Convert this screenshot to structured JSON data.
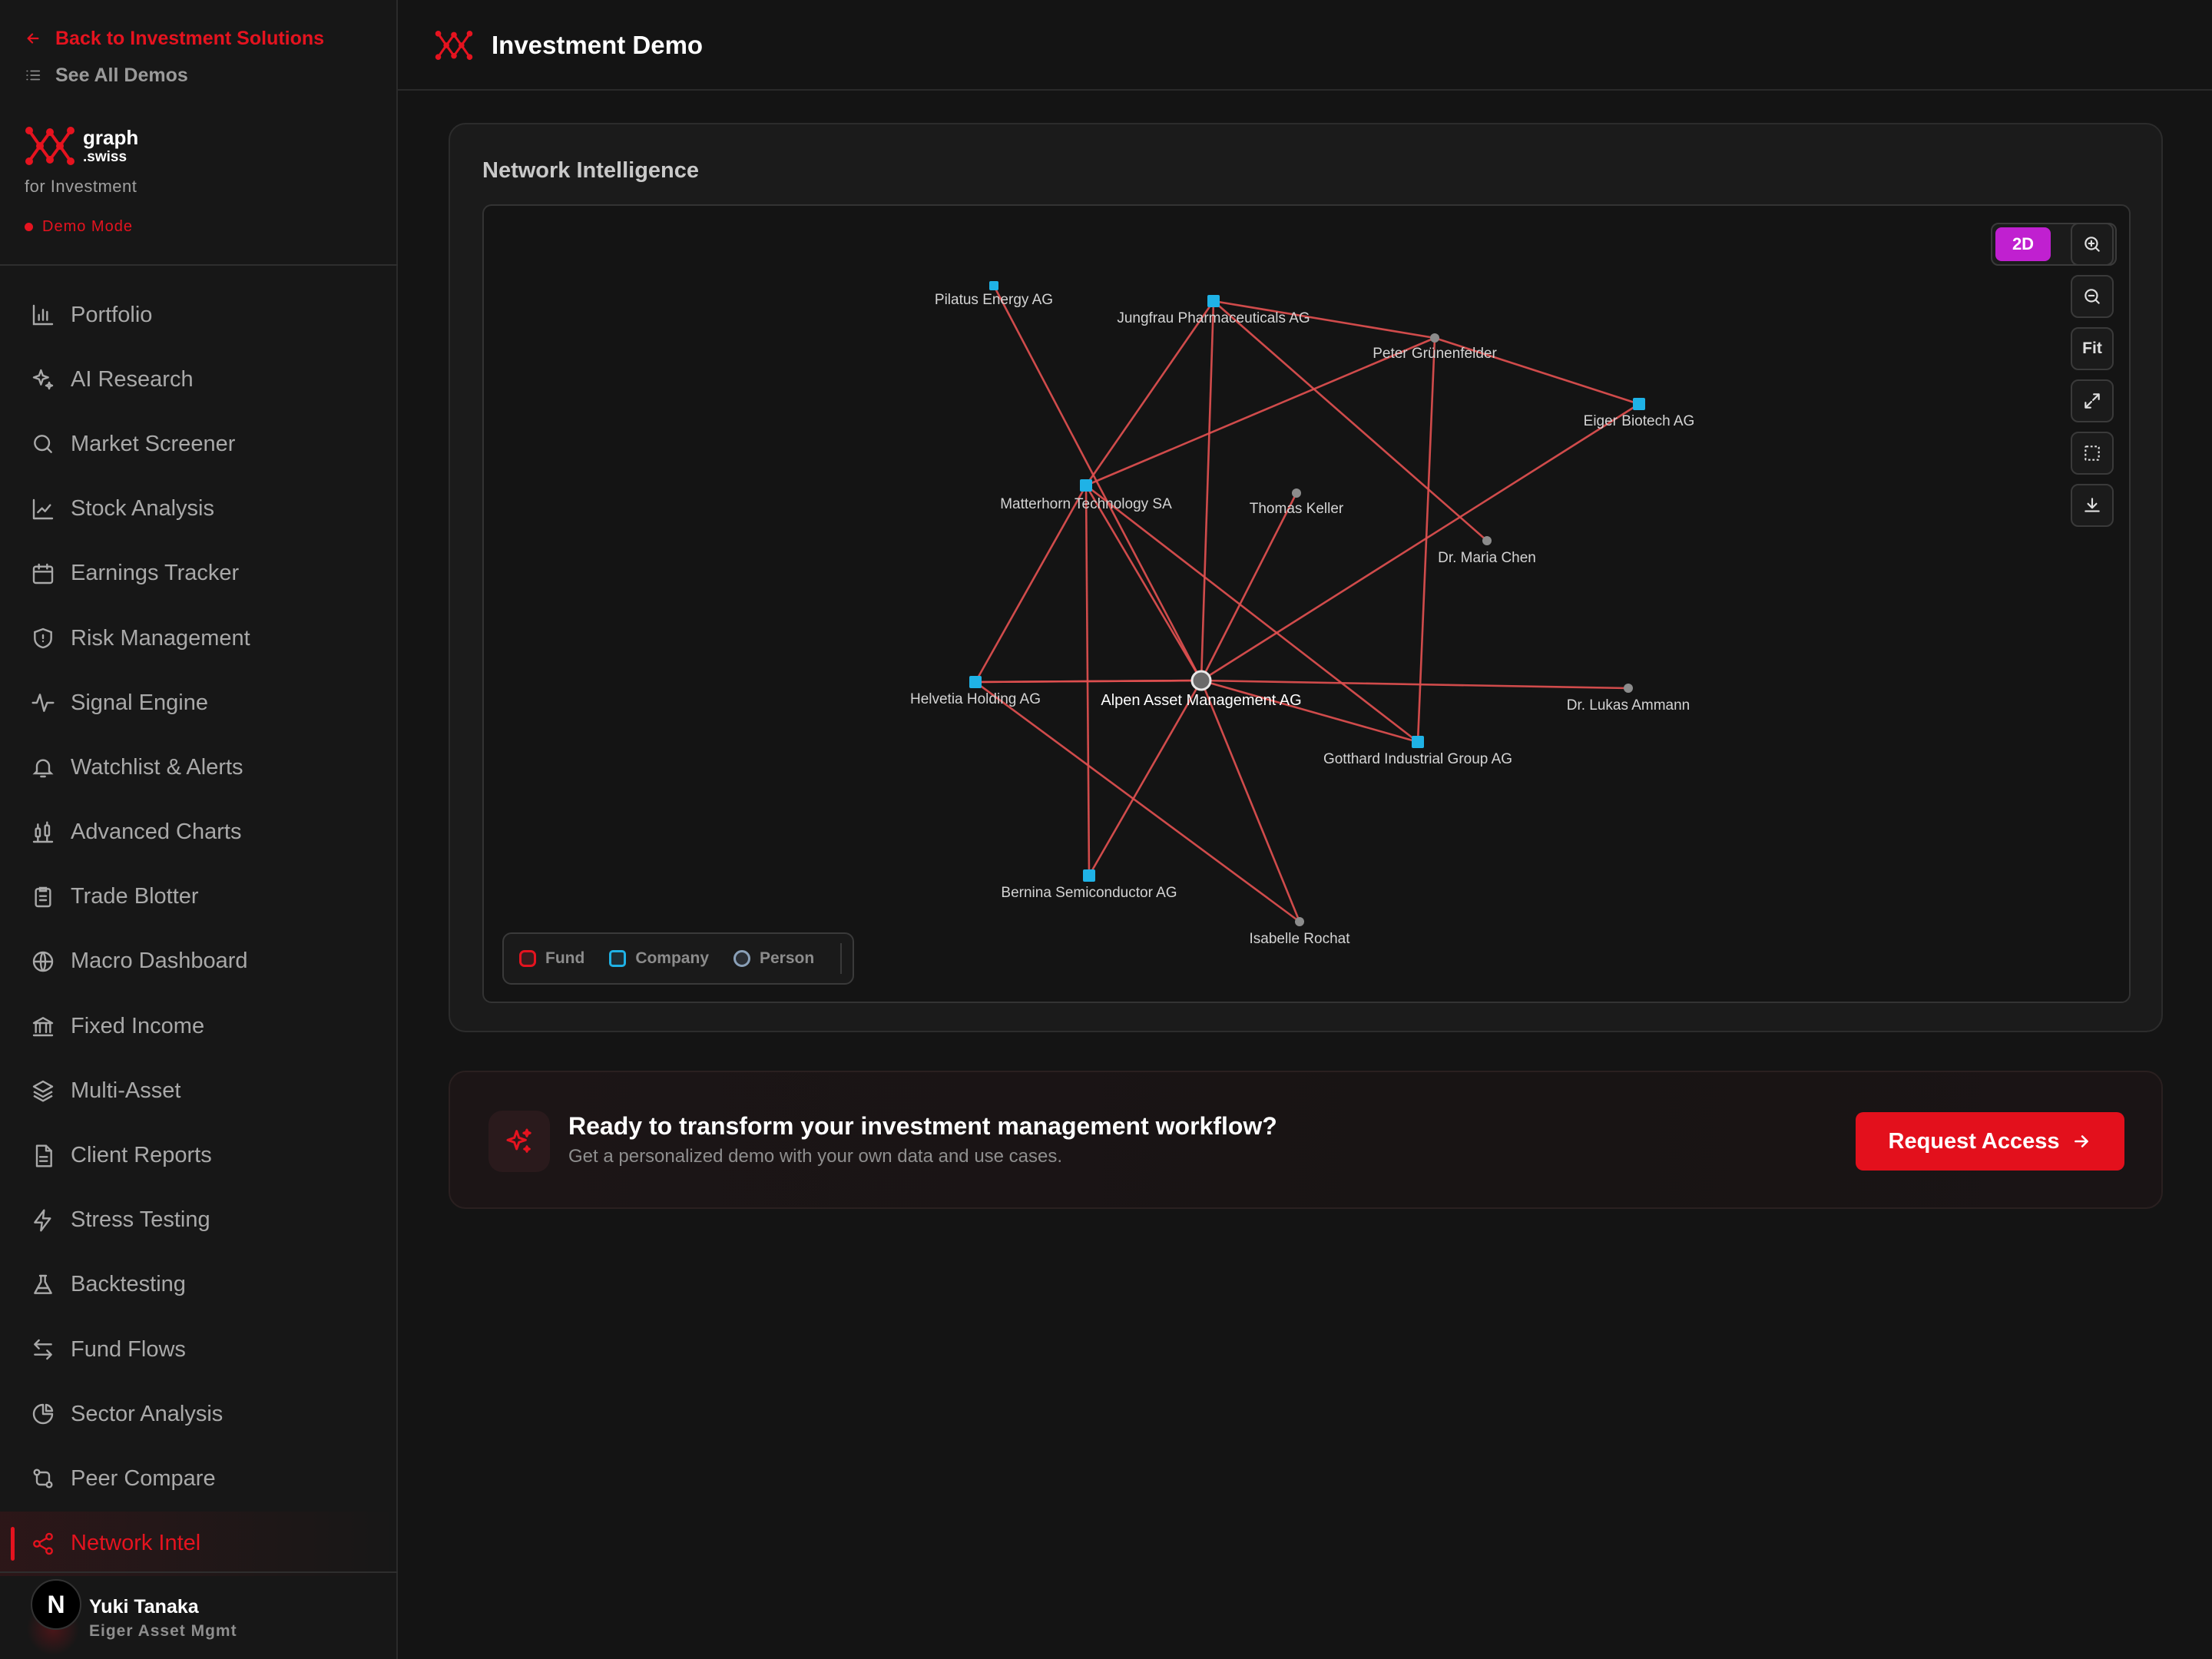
{
  "sidebar": {
    "back_label": "Back to Investment Solutions",
    "see_all_label": "See All Demos",
    "brand_name": "graph",
    "brand_suffix": ".swiss",
    "brand_tagline": "for Investment",
    "demo_mode_label": "Demo Mode",
    "items": [
      {
        "label": "Portfolio",
        "icon": "bar-chart-icon"
      },
      {
        "label": "AI Research",
        "icon": "sparkles-icon"
      },
      {
        "label": "Market Screener",
        "icon": "search-icon"
      },
      {
        "label": "Stock Analysis",
        "icon": "line-chart-icon"
      },
      {
        "label": "Earnings Tracker",
        "icon": "calendar-icon"
      },
      {
        "label": "Risk Management",
        "icon": "shield-icon"
      },
      {
        "label": "Signal Engine",
        "icon": "activity-icon"
      },
      {
        "label": "Watchlist & Alerts",
        "icon": "bell-icon"
      },
      {
        "label": "Advanced Charts",
        "icon": "candlestick-icon"
      },
      {
        "label": "Trade Blotter",
        "icon": "clipboard-icon"
      },
      {
        "label": "Macro Dashboard",
        "icon": "globe-icon"
      },
      {
        "label": "Fixed Income",
        "icon": "bank-icon"
      },
      {
        "label": "Multi-Asset",
        "icon": "layers-icon"
      },
      {
        "label": "Client Reports",
        "icon": "document-icon"
      },
      {
        "label": "Stress Testing",
        "icon": "lightning-icon"
      },
      {
        "label": "Backtesting",
        "icon": "flask-icon"
      },
      {
        "label": "Fund Flows",
        "icon": "arrows-swap-icon"
      },
      {
        "label": "Sector Analysis",
        "icon": "pie-chart-icon"
      },
      {
        "label": "Peer Compare",
        "icon": "git-compare-icon"
      },
      {
        "label": "Network Intel",
        "icon": "share-icon",
        "active": true
      }
    ],
    "user": {
      "avatar_initial": "N",
      "name": "Yuki Tanaka",
      "org": "Eiger Asset Mgmt"
    }
  },
  "header": {
    "title": "Investment Demo"
  },
  "network": {
    "title": "Network Intelligence",
    "mode_label": "2D",
    "fit_label": "Fit",
    "legend": {
      "fund": "Fund",
      "company": "Company",
      "person": "Person"
    },
    "nodes": [
      {
        "label": "Alpen Asset Management AG",
        "type": "fund"
      },
      {
        "label": "Pilatus Energy AG",
        "type": "company"
      },
      {
        "label": "Jungfrau Pharmaceuticals AG",
        "type": "company"
      },
      {
        "label": "Peter Grünenfelder",
        "type": "person"
      },
      {
        "label": "Eiger Biotech AG",
        "type": "company"
      },
      {
        "label": "Matterhorn Technology SA",
        "type": "company"
      },
      {
        "label": "Thomas Keller",
        "type": "person"
      },
      {
        "label": "Dr. Maria Chen",
        "type": "person"
      },
      {
        "label": "Helvetia Holding AG",
        "type": "company"
      },
      {
        "label": "Dr. Lukas Ammann",
        "type": "person"
      },
      {
        "label": "Gotthard Industrial Group AG",
        "type": "company"
      },
      {
        "label": "Bernina Semiconductor AG",
        "type": "company"
      },
      {
        "label": "Isabelle Rochat",
        "type": "person"
      }
    ],
    "colors": {
      "fund": "#e5131f",
      "company": "#1fb2e6",
      "person": "#8c8c8c",
      "edge": "#e05050",
      "mode_active": "#c020d0"
    }
  },
  "cta": {
    "title": "Ready to transform your investment management workflow?",
    "subtitle": "Get a personalized demo with your own data and use cases.",
    "button_label": "Request Access"
  }
}
